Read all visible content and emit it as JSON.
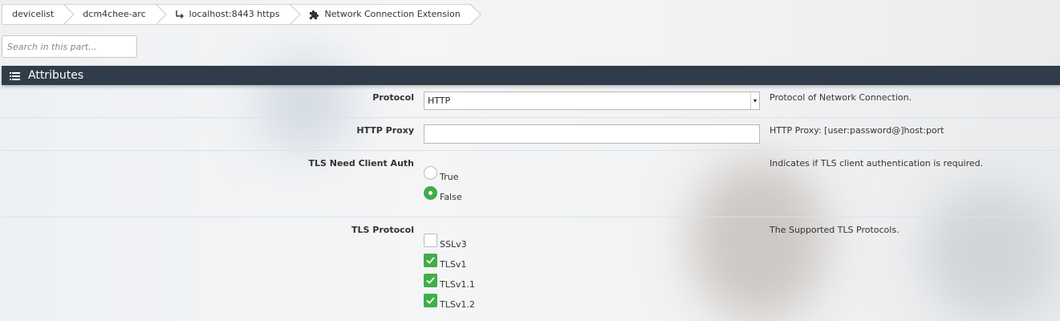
{
  "breadcrumb": [
    {
      "label": "devicelist",
      "icon": ""
    },
    {
      "label": "dcm4chee-arc",
      "icon": ""
    },
    {
      "label": "localhost:8443 https",
      "icon": "return-arrow-icon"
    },
    {
      "label": "Network Connection Extension",
      "icon": "puzzle-icon"
    }
  ],
  "search": {
    "placeholder": "Search in this part..."
  },
  "section": {
    "title": "Attributes",
    "icon": "list-icon"
  },
  "fields": {
    "protocol": {
      "label": "Protocol",
      "value": "HTTP",
      "description": "Protocol of Network Connection."
    },
    "http_proxy": {
      "label": "HTTP Proxy",
      "value": "",
      "description": "HTTP Proxy: [user:password@]host:port"
    },
    "tls_need_client_auth": {
      "label": "TLS Need Client Auth",
      "options": [
        {
          "label": "True",
          "checked": false
        },
        {
          "label": "False",
          "checked": true
        }
      ],
      "description": "Indicates if TLS client authentication is required."
    },
    "tls_protocol": {
      "label": "TLS Protocol",
      "options": [
        {
          "label": "SSLv3",
          "checked": false
        },
        {
          "label": "TLSv1",
          "checked": true
        },
        {
          "label": "TLSv1.1",
          "checked": true
        },
        {
          "label": "TLSv1.2",
          "checked": true
        }
      ],
      "description": "The Supported TLS Protocols."
    }
  },
  "colors": {
    "header_bg": "#2f3d4b",
    "checked_green": "#3fae49"
  }
}
